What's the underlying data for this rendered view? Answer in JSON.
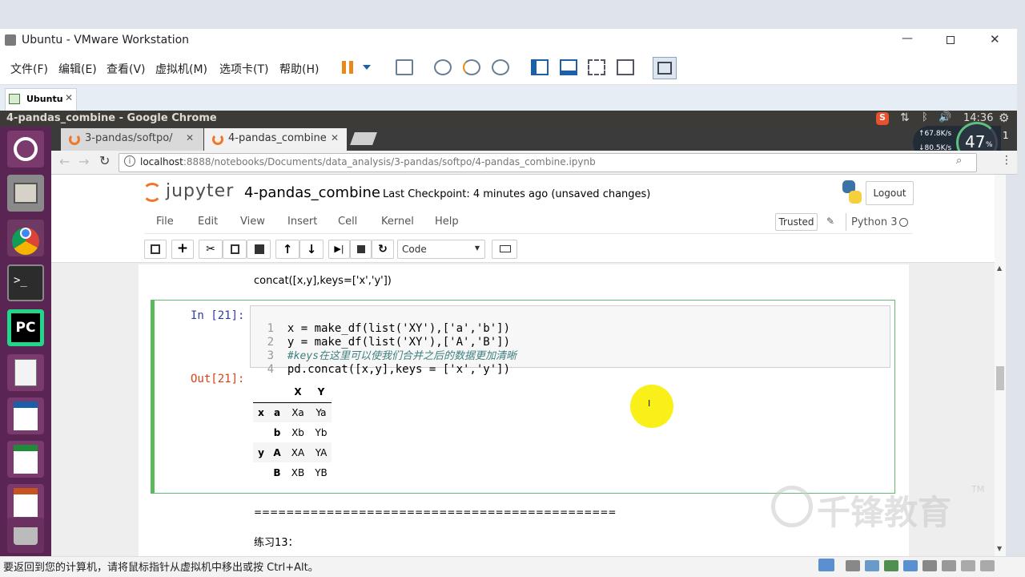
{
  "vmware": {
    "title": "Ubuntu - VMware Workstation",
    "menu": [
      "文件(F)",
      "编辑(E)",
      "查看(V)",
      "虚拟机(M)",
      "选项卡(T)",
      "帮助(H)"
    ],
    "tab_label": "Ubuntu",
    "status_text": "要返回到您的计算机，请将鼠标指针从虚拟机中移出或按 Ctrl+Alt。"
  },
  "ubuntu": {
    "window_title": "4-pandas_combine - Google Chrome",
    "clock": "14:36",
    "net_up": "↑67.8K/s",
    "net_down": "↓80.5K/s",
    "cpu_percent": "47",
    "cpu_unit": "%",
    "workspace": "1"
  },
  "chrome": {
    "tabs": [
      {
        "label": "3-pandas/softpo/",
        "active": false
      },
      {
        "label": "4-pandas_combine",
        "active": true
      }
    ],
    "url_host": "localhost",
    "url_rest": ":8888/notebooks/Documents/data_analysis/3-pandas/softpo/4-pandas_combine.ipynb"
  },
  "jupyter": {
    "logo_text": "jupyter",
    "notebook_name": "4-pandas_combine",
    "checkpoint": "Last Checkpoint: 4 minutes ago (unsaved changes)",
    "logout": "Logout",
    "menu": [
      "File",
      "Edit",
      "View",
      "Insert",
      "Cell",
      "Kernel",
      "Help"
    ],
    "trusted": "Trusted",
    "kernel": "Python 3",
    "cell_type": "Code"
  },
  "notebook": {
    "markdown_above": "concat([x,y],keys=['x','y'])",
    "in_prompt": "In [21]:",
    "out_prompt": "Out[21]:",
    "code_lines": [
      {
        "num": "1",
        "text": "x = make_df(list('XY'),['a','b'])"
      },
      {
        "num": "2",
        "text": "y = make_df(list('XY'),['A','B'])"
      },
      {
        "num": "3",
        "text": "#keys在这里可以使我们合并之后的数据更加清晰"
      },
      {
        "num": "4",
        "text": "pd.concat([x,y],keys = ['x','y'])"
      }
    ],
    "table": {
      "columns": [
        "X",
        "Y"
      ],
      "rows": [
        {
          "outer": "x",
          "inner": "a",
          "X": "Xa",
          "Y": "Ya"
        },
        {
          "outer": "",
          "inner": "b",
          "X": "Xb",
          "Y": "Yb"
        },
        {
          "outer": "y",
          "inner": "A",
          "X": "XA",
          "Y": "YA"
        },
        {
          "outer": "",
          "inner": "B",
          "X": "XB",
          "Y": "YB"
        }
      ]
    },
    "separator": "=============================================",
    "exercise": "练习13："
  },
  "watermark": "千锋教育",
  "watermark_tm": "TM",
  "cursor_char": "I"
}
